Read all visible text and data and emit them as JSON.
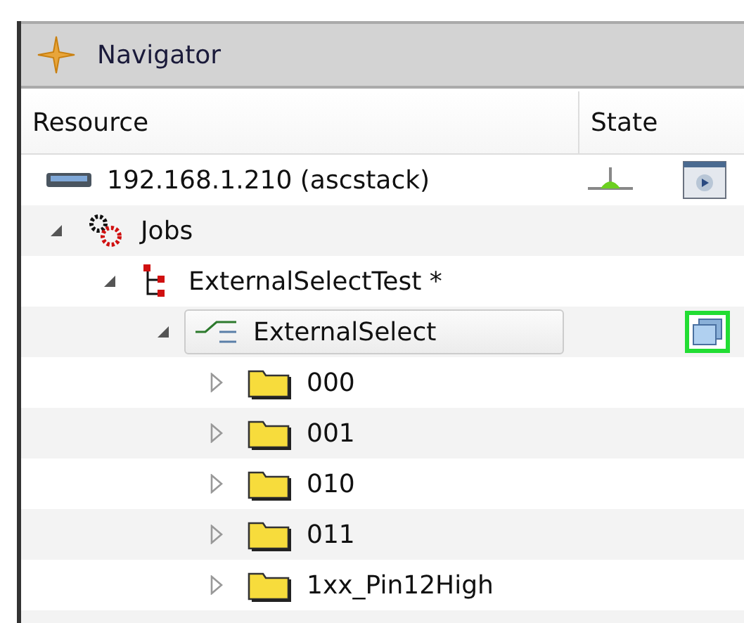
{
  "panel": {
    "title": "Navigator"
  },
  "columns": [
    "Resource",
    "State"
  ],
  "tree": [
    {
      "label": "192.168.1.210 (ascstack)",
      "kind": "server",
      "online": true,
      "selected": false,
      "children": [
        {
          "label": "Jobs",
          "kind": "jobs",
          "selected": false,
          "expanded": true,
          "children": [
            {
              "label": "ExternalSelectTest *",
              "kind": "job",
              "selected": false,
              "expanded": true,
              "children": [
                {
                  "label": "ExternalSelect",
                  "kind": "flow",
                  "open_window": true,
                  "selected": true,
                  "expanded": true,
                  "children": [
                    {
                      "label": "000",
                      "kind": "folder",
                      "selected": false,
                      "expanded": false
                    },
                    {
                      "label": "001",
                      "kind": "folder",
                      "selected": false,
                      "expanded": false
                    },
                    {
                      "label": "010",
                      "kind": "folder",
                      "selected": false,
                      "expanded": false
                    },
                    {
                      "label": "011",
                      "kind": "folder",
                      "selected": false,
                      "expanded": false
                    },
                    {
                      "label": "1xx_Pin12High",
                      "kind": "folder",
                      "selected": false,
                      "expanded": false
                    }
                  ]
                }
              ]
            }
          ]
        }
      ]
    }
  ]
}
